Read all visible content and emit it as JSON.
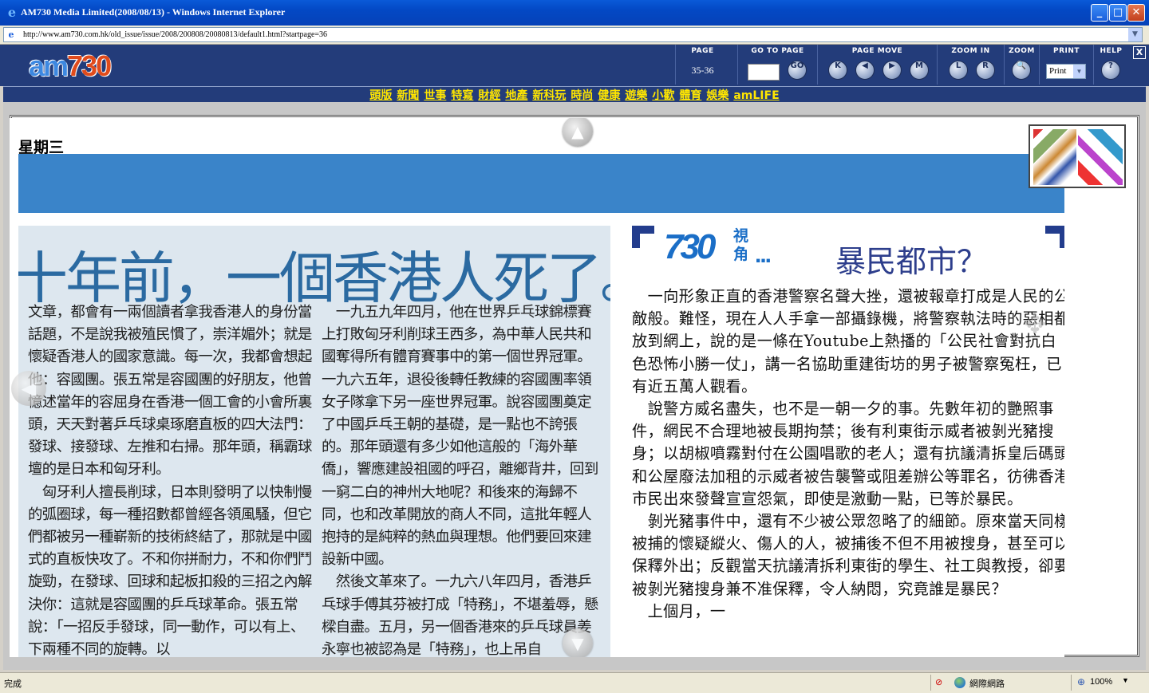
{
  "window": {
    "title": "AM730 Media Limited(2008/08/13) - Windows Internet Explorer",
    "minimize": "_",
    "maximize": "□",
    "close": "✕"
  },
  "address": {
    "url": "http://www.am730.com.hk/old_issue/issue/2008/200808/20080813/default1.html?startpage=36"
  },
  "toolbar": {
    "logo_am": "am",
    "logo_num": "730",
    "page_label": "PAGE",
    "page_value": "35-36",
    "goto_label": "GO TO PAGE",
    "go_button": "GO",
    "pagemove_label": "PAGE MOVE",
    "first": "K",
    "prev": "◀",
    "next": "▶",
    "last": "M",
    "zoomin_label": "ZOOM IN",
    "zoom_l": "L",
    "zoom_r": "R",
    "zoom_label": "ZOOM",
    "zoom_icon": "🔍",
    "print_label": "PRINT",
    "print_value": "Print",
    "help_label": "HELP",
    "help_icon": "?",
    "close_x": "X"
  },
  "nav": [
    "頭版",
    "新聞",
    "世事",
    "特寫",
    "財經",
    "地產",
    "新科玩",
    "時尚",
    "健康",
    "遊樂",
    "小歡",
    "體育",
    "娛樂",
    "amLIFE"
  ],
  "page": {
    "weekday": "星期三",
    "left_headline": "十年前，一個香港人死了。",
    "left_col1": "文章，都會有一兩個讀者拿我香港人的身份當話題，不是說我被殖民慣了，崇洋媚外；就是懷疑香港人的國家意識。每一次，我都會想起他：容國團。張五常是容國團的好朋友，他曾憶述當年的容屈身在香港一個工會的小會所裏頭，天天對著乒乓球桌琢磨直板的四大法門：發球、接發球、左推和右掃。那年頭，稱霸球壇的是日本和匈牙利。\n　匈牙利人擅長削球，日本則發明了以快制慢的弧圈球，每一種招數都曾經各領風騷，但它們都被另一種嶄新的技術終結了，那就是中國式的直板快攻了。不和你拼耐力，不和你們鬥旋勁，在發球、回球和起板扣殺的三招之內解決你：這就是容國團的乒乓球革命。張五常說：「一招反手發球，同一動作，可以有上、下兩種不同的旋轉。以",
    "left_col2": "　一九五九年四月，他在世界乒乓球錦標賽上打敗匈牙利削球王西多，為中華人民共和國奪得所有體育賽事中的第一個世界冠軍。一九六五年，退役後轉任教練的容國團率領女子隊拿下另一座世界冠軍。說容國團奠定了中國乒乓王朝的基礎，是一點也不誇張的。那年頭還有多少如他這般的「海外華僑」，響應建設祖國的呼召，離鄉背井，回到一窮二白的神州大地呢？和後來的海歸不同，也和改革開放的商人不同，這批年輕人抱持的是純粹的熱血與理想。他們要回來建設新中國。\n　然後文革來了。一九六八年四月，香港乒乓球手傅其芬被打成「特務」，不堪羞辱，懸樑自盡。五月，另一個香港來的乒乓球員姜永寧也被認為是「特務」，也上吊自",
    "tag_num": "730",
    "tag_sub": "視角",
    "tag_dots": "...",
    "right_headline": "暴民都市？",
    "right_text": "　一向形象正直的香港警察名聲大挫，還被報章打成是人民的公敵般。難怪，現在人人手拿一部攝錄機，將警察執法時的惡相都放到網上，說的是一條在Youtube上熱播的「公民社會對抗白色恐怖小勝一仗」，講一名協助重建街坊的男子被警察冤枉，已有近五萬人觀看。\n　說警方威名盡失，也不是一朝一夕的事。先數年初的艷照事件，網民不合理地被長期拘禁；後有利東街示威者被剝光豬搜身；以胡椒噴霧對付在公園唱歌的老人；還有抗議清拆皇后碼頭和公屋廢法加租的示威者被告襲警或阻差辦公等罪名，彷彿香港市民出來發聲宣宣怨氣，即使是激動一點，已等於暴民。\n　剝光豬事件中，還有不少被公眾忽略了的細節。原來當天同樣被捕的懷疑縱火、傷人的人，被捕後不但不用被搜身，甚至可以保釋外出；反觀當天抗議清拆利東街的學生、社工與教授，卻要被剝光豬搜身兼不准保釋，令人納悶，究竟誰是暴民？\n　上個月，一"
  },
  "status": {
    "text": "完成",
    "zone": "網際網路",
    "zoom": "100%",
    "zoom_arrow": "▼"
  }
}
